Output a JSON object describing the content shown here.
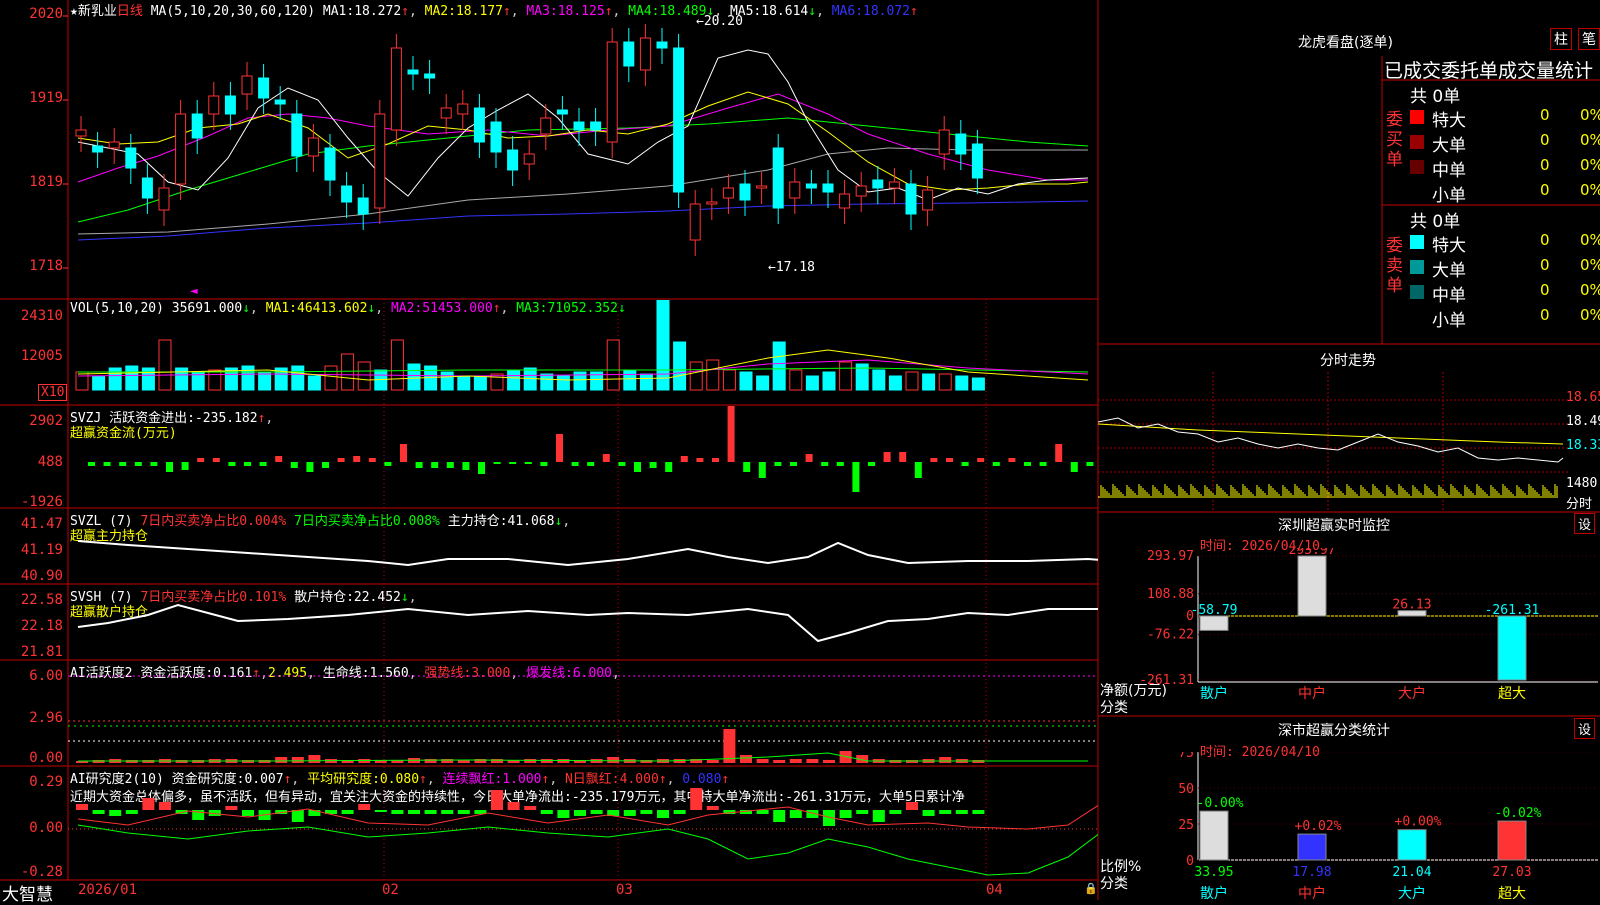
{
  "colors": {
    "up": "#ff3333",
    "down": "#00ffff",
    "grid": "#aa0000",
    "ma1": "#ffffff",
    "ma2": "#ffff00",
    "ma3": "#ff00ff",
    "ma4": "#00ff00",
    "ma5": "#aaaaaa",
    "ma6": "#3333ff"
  },
  "main": {
    "header": {
      "star": "★",
      "name": "新乳业",
      "period": "日线",
      "ma_def": "MA(5,10,20,30,60,120)",
      "ma": [
        {
          "label": "MA1:",
          "value": "18.272",
          "arrow": "↑"
        },
        {
          "label": "MA2:",
          "value": "18.177",
          "arrow": "↑"
        },
        {
          "label": "MA3:",
          "value": "18.125",
          "arrow": "↑"
        },
        {
          "label": "MA4:",
          "value": "18.489",
          "arrow": "↓"
        },
        {
          "label": "MA5:",
          "value": "18.614",
          "arrow": "↓"
        },
        {
          "label": "MA6:",
          "value": "18.072",
          "arrow": "↑"
        }
      ]
    },
    "price_axis": [
      "2020",
      "1919",
      "1819",
      "1718"
    ],
    "high_label": "←20.20",
    "low_label": "←17.18",
    "marker": "◄"
  },
  "vol": {
    "title": "VOL(5,10,20)",
    "value": "35691.000",
    "arrow": "↓",
    "ma": [
      {
        "label": "MA1:",
        "value": "46413.602",
        "arrow": "↓"
      },
      {
        "label": "MA2:",
        "value": "51453.000",
        "arrow": "↑"
      },
      {
        "label": "MA3:",
        "value": "71052.352",
        "arrow": "↓"
      }
    ],
    "axis": [
      "24310",
      "12005"
    ],
    "unit": "X10"
  },
  "svzj": {
    "title": "SVZJ",
    "label": "活跃资金进出:",
    "value": "-235.182",
    "arrow": "↑",
    "sub": "超赢资金流(万元)",
    "axis": [
      "2902",
      "488",
      "-1926"
    ]
  },
  "svzl": {
    "title": "SVZL (7)",
    "seg1": "7日内买卖净占比0.004%",
    "seg2": "7日内买卖净占比0.008%",
    "seg3": "主力持仓:",
    "value": "41.068",
    "arrow": "↓",
    "sub": "超赢主力持仓",
    "axis": [
      "41.47",
      "41.19",
      "40.90"
    ]
  },
  "svsh": {
    "title": "SVSH (7)",
    "seg1": "7日内买卖净占比0.101%",
    "seg2": "散户持仓:",
    "value": "22.452",
    "arrow": "↓",
    "sub": "超赢散户持仓",
    "axis": [
      "22.58",
      "22.18",
      "21.81"
    ]
  },
  "ai1": {
    "title": "AI活跃度2",
    "label": "资金活跃度:",
    "value": "0.161",
    "arrow": "↑",
    "v2": "2.495",
    "life": "生命线:",
    "life_v": "1.560",
    "strong": "强势线:",
    "strong_v": "3.000",
    "burst": "爆发线:",
    "burst_v": "6.000",
    "axis": [
      "6.00",
      "2.96",
      "0.00"
    ]
  },
  "ai2": {
    "title": "AI研究度2(10)",
    "l1": "资金研究度:",
    "v1": "0.007",
    "l2": "平均研究度:",
    "v2": "0.080",
    "l3": "连续飘红:",
    "v3": "1.000",
    "l4": "N日飘红:",
    "v4": "4.000",
    "v5": "0.080",
    "text": "近期大资金总体偏多，虽不活跃，但有异动，宜关注大资金的持续性，今日大单净流出:-235.179万元，其中特大单净流出:-261.31万元，大单5日累计净",
    "axis": [
      "0.29",
      "0.00",
      "-0.28"
    ]
  },
  "footer": {
    "brand": "大智慧",
    "dates": [
      "2026/01",
      "02",
      "03",
      "04"
    ]
  },
  "dragon": {
    "title": "龙虎看盘(逐单)",
    "tab1": "柱",
    "tab2": "笔",
    "head": "已成交委托单成交量统计",
    "buy_label": "委买单",
    "sell_label": "委卖单",
    "buy_total": "共 0单",
    "sell_total": "共 0单",
    "buy_rows": [
      {
        "name": "特大",
        "n": "0",
        "p": "0%"
      },
      {
        "name": "大单",
        "n": "0",
        "p": "0%"
      },
      {
        "name": "中单",
        "n": "0",
        "p": "0%"
      },
      {
        "name": "小单",
        "n": "0",
        "p": "0%"
      }
    ],
    "sell_rows": [
      {
        "name": "特大",
        "n": "0",
        "p": "0%"
      },
      {
        "name": "大单",
        "n": "0",
        "p": "0%"
      },
      {
        "name": "中单",
        "n": "0",
        "p": "0%"
      },
      {
        "name": "小单",
        "n": "0",
        "p": "0%"
      }
    ]
  },
  "intraday": {
    "title": "分时走势",
    "axis": [
      "18.65",
      "18.49",
      "18.33"
    ],
    "vol": "1480",
    "label": "分时"
  },
  "monitor": {
    "title": "深圳超赢实时监控",
    "set": "设",
    "time": "时间: 2026/04/10",
    "axis": [
      "293.97",
      "108.88",
      "0",
      "-76.22",
      "-261.31"
    ],
    "ylabel": "净额(万元)",
    "xlabel": "分类",
    "bars": [
      {
        "name": "散户",
        "value": "-58.79"
      },
      {
        "name": "中户",
        "value": "293.97"
      },
      {
        "name": "大户",
        "value": "26.13"
      },
      {
        "name": "超大",
        "value": "-261.31"
      }
    ]
  },
  "classify": {
    "title": "深市超赢分类统计",
    "set": "设",
    "time": "时间: 2026/04/10",
    "axis": [
      "75",
      "50",
      "25",
      "0"
    ],
    "ylabel": "比例%",
    "xlabel": "分类",
    "bars": [
      {
        "name": "散户",
        "value": "33.95",
        "change": "-0.00%"
      },
      {
        "name": "中户",
        "value": "17.98",
        "change": "+0.02%"
      },
      {
        "name": "大户",
        "value": "21.04",
        "change": "+0.00%"
      },
      {
        "name": "超大",
        "value": "27.03",
        "change": "-0.02%"
      }
    ]
  }
}
